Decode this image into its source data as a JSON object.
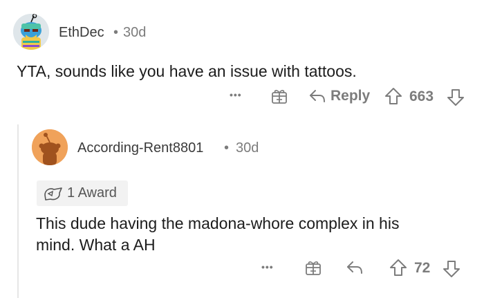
{
  "comment1": {
    "username": "EthDec",
    "separator": "•",
    "age": "30d",
    "text": "YTA, sounds like you have an issue with tattoos.",
    "more_label": "•••",
    "reply_label": "Reply",
    "score": "663"
  },
  "comment2": {
    "username": "According-Rent8801",
    "separator": "•",
    "age": "30d",
    "award_label": "1 Award",
    "text_line1": "This dude having the madona-whore complex in his",
    "text_line2": "mind. What a AH",
    "more_label": "•••",
    "score": "72"
  },
  "colors": {
    "text": "#1c1c1c",
    "muted": "#7c7c7c",
    "avatar2_bg": "#f0a25a",
    "award_bg": "#f2f2f2"
  },
  "icons": [
    "more-icon",
    "gift-icon",
    "reply-icon",
    "upvote-icon",
    "downvote-icon",
    "award-icon"
  ]
}
